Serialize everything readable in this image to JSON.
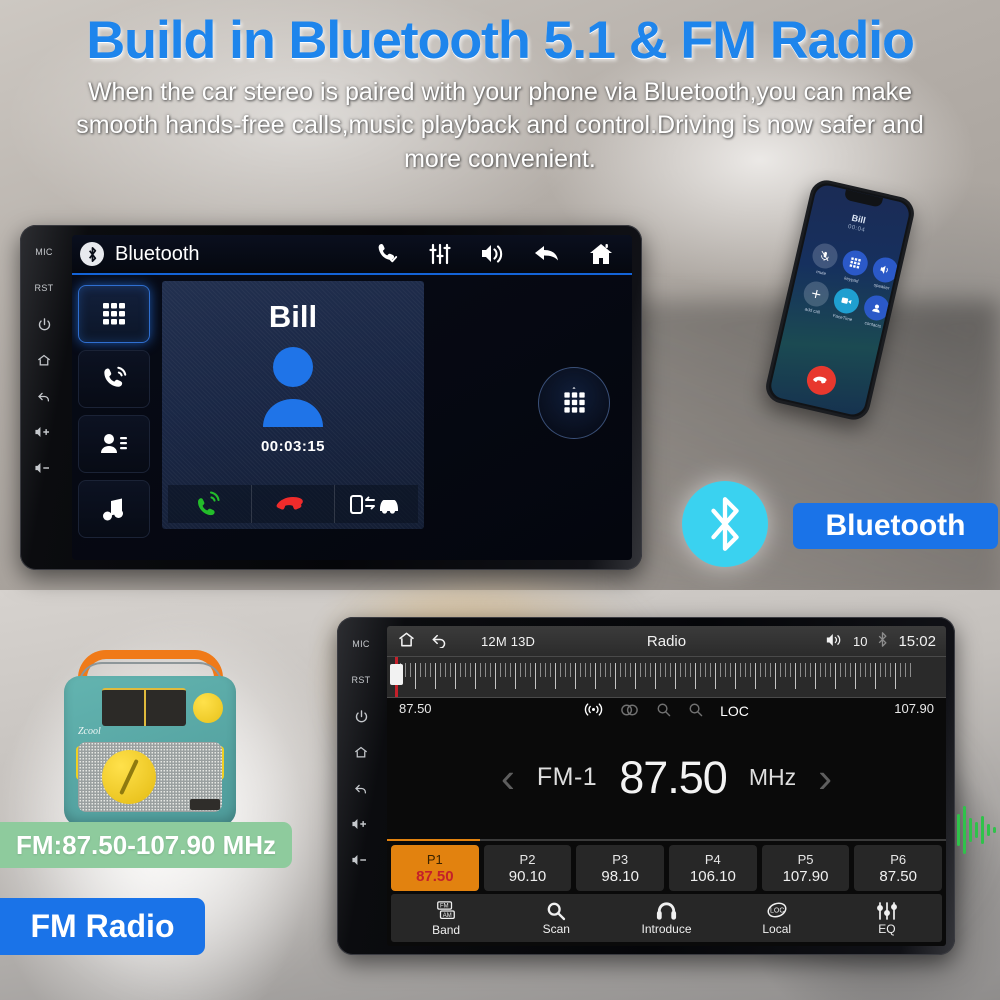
{
  "header": {
    "title": "Build in Bluetooth 5.1 & FM Radio",
    "subtitle": "When the car stereo is paired with your phone via Bluetooth,you can make smooth hands-free calls,music playback and control.Driving is now safer and more convenient.",
    "title_color": "#1e85ec"
  },
  "bluetooth_unit": {
    "bezel": {
      "mic": "MIC",
      "rst": "RST"
    },
    "topbar": {
      "title": "Bluetooth",
      "icons": [
        "bluetooth-logo-icon",
        "phone-check-icon",
        "equalizer-icon",
        "volume-icon",
        "back-icon",
        "home-icon"
      ]
    },
    "sidebar": [
      {
        "name": "keypad",
        "active": true
      },
      {
        "name": "dial",
        "active": false
      },
      {
        "name": "contacts",
        "active": false
      },
      {
        "name": "music",
        "active": false
      }
    ],
    "call": {
      "contact_name": "Bill",
      "duration": "00:03:15",
      "actions": [
        "answer-call",
        "end-call",
        "transfer-audio"
      ]
    },
    "keypad_button": "keypad-icon"
  },
  "radio_unit": {
    "bezel": {
      "mic": "MIC",
      "rst": "RST"
    },
    "topbar": {
      "date": "12M 13D",
      "title": "Radio",
      "volume": "10",
      "clock": "15:02"
    },
    "scale": {
      "min_label": "87.50",
      "max_label": "107.90",
      "needle_position_pct": 1.5,
      "status_icons": [
        "signal-icon",
        "stereo-icon",
        "search-down-icon",
        "search-up-icon"
      ],
      "loc_label": "LOC"
    },
    "tuner": {
      "prev": "‹",
      "band": "FM-1",
      "frequency": "87.50",
      "unit": "MHz",
      "next": "›",
      "accent_color": "#e2820f"
    },
    "presets": [
      {
        "name": "P1",
        "freq": "87.50",
        "active": true
      },
      {
        "name": "P2",
        "freq": "90.10",
        "active": false
      },
      {
        "name": "P3",
        "freq": "98.10",
        "active": false
      },
      {
        "name": "P4",
        "freq": "106.10",
        "active": false
      },
      {
        "name": "P5",
        "freq": "107.90",
        "active": false
      },
      {
        "name": "P6",
        "freq": "87.50",
        "active": false
      }
    ],
    "bottom_bar": [
      {
        "label": "Band",
        "icon": "fm-am-band-icon"
      },
      {
        "label": "Scan",
        "icon": "search-icon"
      },
      {
        "label": "Introduce",
        "icon": "headphones-icon"
      },
      {
        "label": "Local",
        "icon": "loc-icon"
      },
      {
        "label": "EQ",
        "icon": "equalizer-icon"
      }
    ]
  },
  "phone": {
    "contact_name": "Bill",
    "status": "00:04",
    "buttons": [
      {
        "label": "mute",
        "icon": "mic-off-icon",
        "style": "translucent"
      },
      {
        "label": "keypad",
        "icon": "keypad-icon",
        "style": "blue"
      },
      {
        "label": "speaker",
        "icon": "volume-icon",
        "style": "blue"
      },
      {
        "label": "add call",
        "icon": "plus-icon",
        "style": "translucent"
      },
      {
        "label": "FaceTime",
        "icon": "video-icon",
        "style": "cyan"
      },
      {
        "label": "contacts",
        "icon": "contacts-icon",
        "style": "blue"
      }
    ],
    "hangup": "end-call-icon"
  },
  "badges": {
    "bluetooth": {
      "label": "Bluetooth",
      "color": "#1a73e8",
      "circle_color": "#3ad2f0"
    },
    "fm_range": {
      "label": "FM:87.50-107.90 MHz",
      "color": "#8ecb9d"
    },
    "fm_radio": {
      "label": "FM Radio",
      "color": "#1a73e8"
    }
  },
  "retro_radio": {
    "brand": "Zcool"
  }
}
